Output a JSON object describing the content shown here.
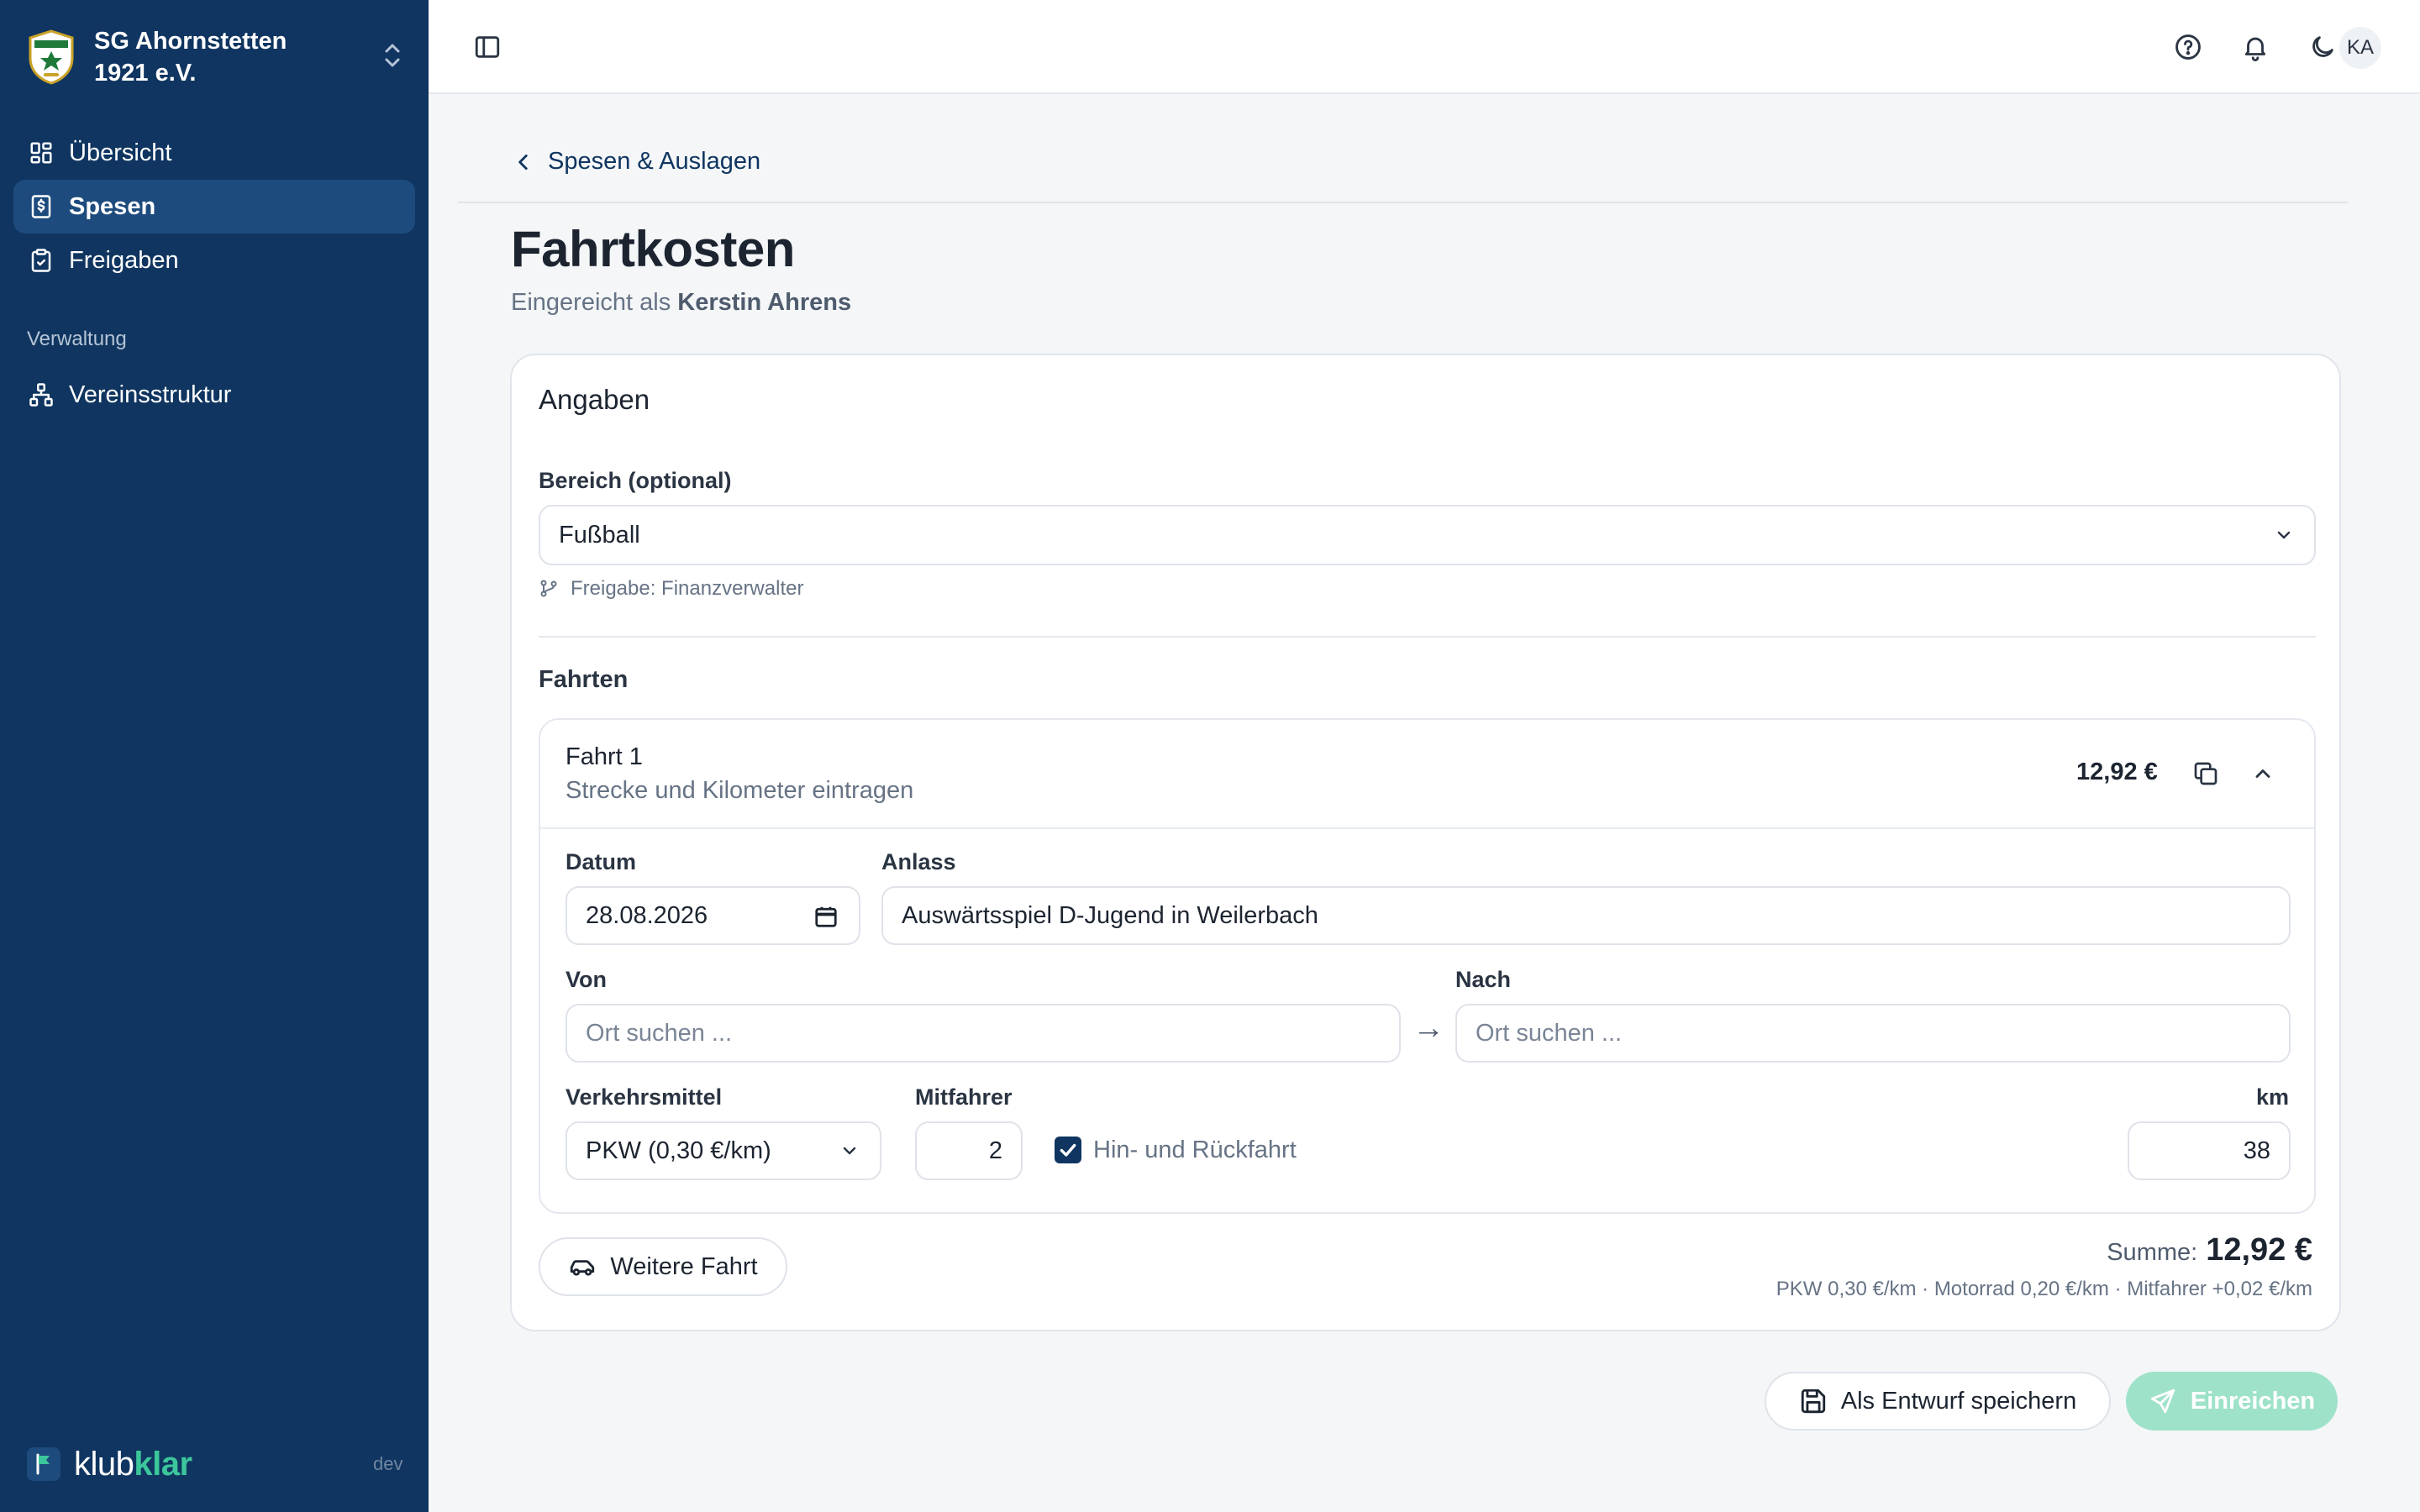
{
  "sidebar": {
    "org_name": "SG Ahornstetten 1921 e.V.",
    "items": [
      {
        "label": "Übersicht",
        "icon": "dashboard-icon"
      },
      {
        "label": "Spesen",
        "icon": "receipt-icon",
        "active": true
      },
      {
        "label": "Freigaben",
        "icon": "clipboard-check-icon"
      }
    ],
    "section_label": "Verwaltung",
    "admin_items": [
      {
        "label": "Vereinsstruktur",
        "icon": "org-tree-icon"
      }
    ],
    "brand_klub": "klub",
    "brand_klar": "klar",
    "env": "dev"
  },
  "header": {
    "avatar_initials": "KA",
    "icons": [
      "sidebar-toggle-icon",
      "help-icon",
      "bell-icon",
      "moon-icon"
    ]
  },
  "page": {
    "back_label": "Spesen & Auslagen",
    "title": "Fahrtkosten",
    "submitted_as_prefix": "Eingereicht als",
    "submitted_as_name": "Kerstin Ahrens"
  },
  "form": {
    "card_title": "Angaben",
    "bereich_label": "Bereich (optional)",
    "bereich_value": "Fußball",
    "freigabe_hint": "Freigabe: Finanzverwalter",
    "fahrten_label": "Fahrten",
    "trip": {
      "title": "Fahrt 1",
      "subtitle": "Strecke und Kilometer eintragen",
      "amount": "12,92 €",
      "datum_label": "Datum",
      "datum_value": "28.08.2026",
      "anlass_label": "Anlass",
      "anlass_value": "Auswärtsspiel D-Jugend in Weilerbach",
      "von_label": "Von",
      "von_placeholder": "Ort suchen ...",
      "nach_label": "Nach",
      "nach_placeholder": "Ort suchen ...",
      "arrow": "→",
      "verkehrsmittel_label": "Verkehrsmittel",
      "verkehrsmittel_value": "PKW (0,30 €/km)",
      "mitfahrer_label": "Mitfahrer",
      "mitfahrer_value": "2",
      "roundtrip_label": "Hin- und Rückfahrt",
      "roundtrip_checked": true,
      "km_label": "km",
      "km_value": "38"
    },
    "add_trip_label": "Weitere Fahrt",
    "sum_label": "Summe:",
    "sum_value": "12,92 €",
    "rates_note": "PKW 0,30 €/km · Motorrad 0,20 €/km · Mitfahrer +0,02 €/km"
  },
  "actions": {
    "draft_label": "Als Entwurf speichern",
    "submit_label": "Einreichen"
  },
  "colors": {
    "sidebar_bg": "#0f3560",
    "sidebar_active": "#1e4b7d",
    "brand_accent": "#3cc69b",
    "primary_button": "#9ee2c9",
    "checkbox": "#0f3560"
  }
}
